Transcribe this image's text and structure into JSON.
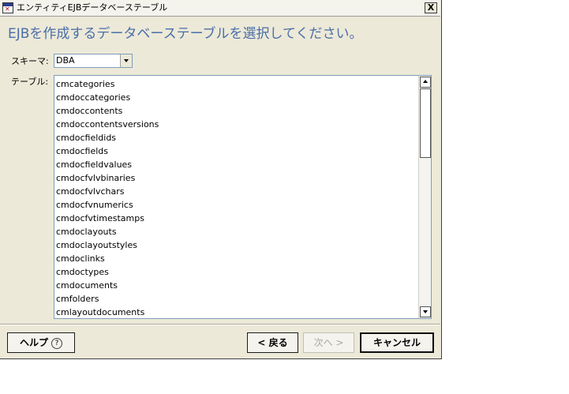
{
  "window": {
    "title": "エンティティEJBデータベーステーブル",
    "close_label": "X"
  },
  "heading": "EJBを作成するデータベーステーブルを選択してください。",
  "schema": {
    "label": "スキーマ:",
    "value": "DBA"
  },
  "table": {
    "label": "テーブル:",
    "items": [
      "cmcategories",
      "cmdoccategories",
      "cmdoccontents",
      "cmdoccontentsversions",
      "cmdocfieldids",
      "cmdocfields",
      "cmdocfieldvalues",
      "cmdocfvlvbinaries",
      "cmdocfvlvchars",
      "cmdocfvnumerics",
      "cmdocfvtimestamps",
      "cmdoclayouts",
      "cmdoclayoutstyles",
      "cmdoclinks",
      "cmdoctypes",
      "cmdocuments",
      "cmfolders",
      "cmlayoutdocuments"
    ]
  },
  "buttons": {
    "help": "ヘルプ",
    "help_icon": "?",
    "back": "< 戻る",
    "next": "次へ >",
    "cancel": "キャンセル"
  },
  "colors": {
    "heading": "#4a6ea8",
    "dialog_bg": "#ece9d8",
    "list_border": "#7f9db9"
  }
}
